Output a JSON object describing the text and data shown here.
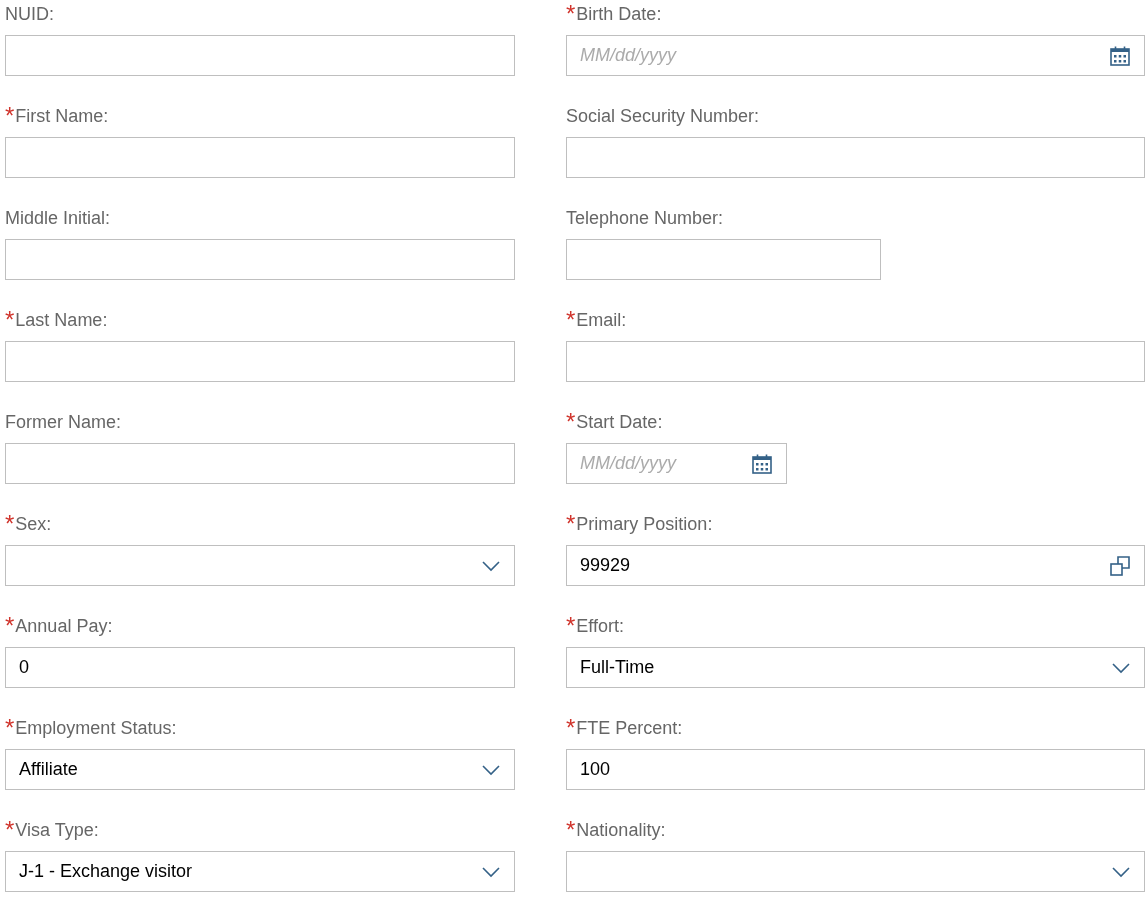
{
  "fields": [
    {
      "label": "NUID:",
      "kind": "text"
    },
    {
      "label": "Birth Date:",
      "marker": "*",
      "kind": "date",
      "placeholder": "MM/dd/yyyy"
    },
    {
      "label": "First Name:",
      "marker": "*",
      "kind": "text"
    },
    {
      "label": "Social Security Number:",
      "kind": "text"
    },
    {
      "label": "Middle Initial:",
      "kind": "text"
    },
    {
      "label": "Telephone Number:",
      "kind": "text"
    },
    {
      "label": "Last Name:",
      "marker": "*",
      "kind": "text"
    },
    {
      "label": "Email:",
      "marker": "*",
      "kind": "text"
    },
    {
      "label": "Former Name:",
      "kind": "text"
    },
    {
      "label": "Start Date:",
      "marker": "*",
      "kind": "date",
      "placeholder": "MM/dd/yyyy"
    },
    {
      "label": "Sex:",
      "marker": "*",
      "kind": "select"
    },
    {
      "label": "Primary Position:",
      "marker": "*",
      "kind": "lookup",
      "value": "99929"
    },
    {
      "label": "Annual Pay:",
      "marker": "*",
      "kind": "text",
      "value": "0"
    },
    {
      "label": "Effort:",
      "marker": "*",
      "kind": "select",
      "value": "Full-Time"
    },
    {
      "label": "Employment Status:",
      "marker": "*",
      "kind": "select",
      "value": "Affiliate"
    },
    {
      "label": "FTE Percent:",
      "marker": "*",
      "kind": "text",
      "value": "100"
    },
    {
      "label": "Visa Type:",
      "marker": "*",
      "kind": "select",
      "value": "J-1 - Exchange visitor"
    },
    {
      "label": "Nationality:",
      "marker": "*",
      "kind": "select"
    }
  ]
}
